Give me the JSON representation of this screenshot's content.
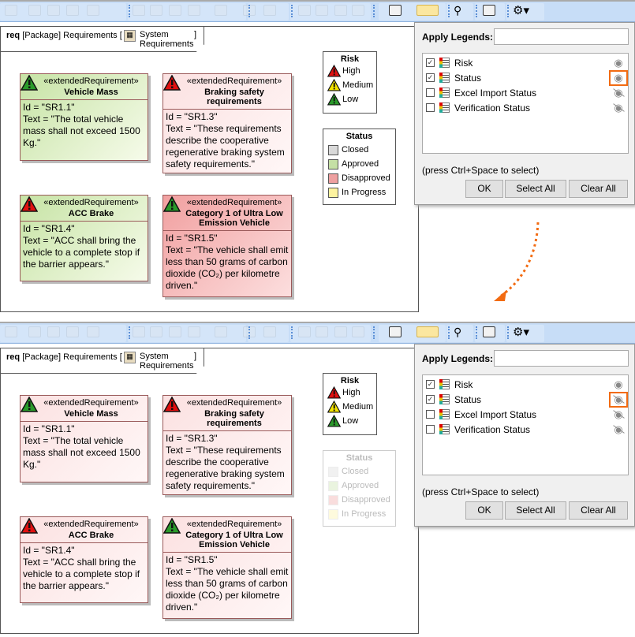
{
  "panels": [
    {
      "diagram_header": {
        "kind": "req",
        "type": "[Package]",
        "name": "Requirements [",
        "package": "System Requirements",
        "close": "]"
      },
      "requirements": [
        {
          "stereotype": "«extendedRequirement»",
          "name": "Vehicle Mass",
          "id": "Id = \"SR1.1\"",
          "text": "Text = \"The total vehicle mass shall not exceed 1500 Kg.\"",
          "risk": "low",
          "status": "approved"
        },
        {
          "stereotype": "«extendedRequirement»",
          "name": "Braking safety requirements",
          "id": "Id = \"SR1.3\"",
          "text": "Text = \"These requirements describe the cooperative regenerative braking system safety requirements.\"",
          "risk": "high",
          "status": "none"
        },
        {
          "stereotype": "«extendedRequirement»",
          "name": "ACC Brake",
          "id": "Id = \"SR1.4\"",
          "text": "Text = \"ACC shall bring the vehicle to a complete stop if the barrier appears.\"",
          "risk": "high",
          "status": "approved"
        },
        {
          "stereotype": "«extendedRequirement»",
          "name": "Category 1 of Ultra Low Emission Vehicle",
          "id": "Id = \"SR1.5\"",
          "text": "Text = \"The vehicle shall emit less than 50 grams of carbon dioxide (CO₂) per kilometre driven.\"",
          "risk": "low",
          "status": "disapproved"
        }
      ],
      "risk_legend": {
        "title": "Risk",
        "items": [
          {
            "label": "High",
            "color": "#e01010"
          },
          {
            "label": "Medium",
            "color": "#f5e400"
          },
          {
            "label": "Low",
            "color": "#2a9a2a"
          }
        ]
      },
      "status_legend": {
        "title": "Status",
        "visible": true,
        "items": [
          {
            "label": "Closed",
            "color": "#d9d9d9"
          },
          {
            "label": "Approved",
            "color": "#c5e0a5"
          },
          {
            "label": "Disapproved",
            "color": "#eea0a0"
          },
          {
            "label": "In Progress",
            "color": "#fdf3a0"
          }
        ]
      },
      "dialog": {
        "title": "Apply Legends:",
        "search_value": "",
        "hint": "(press Ctrl+Space to select)",
        "ok": "OK",
        "select_all": "Select All",
        "clear_all": "Clear All",
        "items": [
          {
            "label": "Risk",
            "checked": true,
            "visible": true
          },
          {
            "label": "Status",
            "checked": true,
            "visible": true
          },
          {
            "label": "Excel Import Status",
            "checked": false,
            "visible": false
          },
          {
            "label": "Verification Status",
            "checked": false,
            "visible": false
          }
        ]
      }
    },
    {
      "diagram_header": {
        "kind": "req",
        "type": "[Package]",
        "name": "Requirements [",
        "package": "System Requirements",
        "close": "]"
      },
      "requirements": [
        {
          "stereotype": "«extendedRequirement»",
          "name": "Vehicle Mass",
          "id": "Id = \"SR1.1\"",
          "text": "Text = \"The total vehicle mass shall not exceed 1500 Kg.\"",
          "risk": "low",
          "status": "none"
        },
        {
          "stereotype": "«extendedRequirement»",
          "name": "Braking safety requirements",
          "id": "Id = \"SR1.3\"",
          "text": "Text = \"These requirements describe the cooperative regenerative braking system safety requirements.\"",
          "risk": "high",
          "status": "none"
        },
        {
          "stereotype": "«extendedRequirement»",
          "name": "ACC Brake",
          "id": "Id = \"SR1.4\"",
          "text": "Text = \"ACC shall bring the vehicle to a complete stop if the barrier appears.\"",
          "risk": "high",
          "status": "none"
        },
        {
          "stereotype": "«extendedRequirement»",
          "name": "Category 1 of Ultra Low Emission Vehicle",
          "id": "Id = \"SR1.5\"",
          "text": "Text = \"The vehicle shall emit less than 50 grams of carbon dioxide (CO₂) per kilometre driven.\"",
          "risk": "low",
          "status": "none"
        }
      ],
      "risk_legend": {
        "title": "Risk",
        "items": [
          {
            "label": "High",
            "color": "#e01010"
          },
          {
            "label": "Medium",
            "color": "#f5e400"
          },
          {
            "label": "Low",
            "color": "#2a9a2a"
          }
        ]
      },
      "status_legend": {
        "title": "Status",
        "visible": false,
        "items": [
          {
            "label": "Closed",
            "color": "#d9d9d9"
          },
          {
            "label": "Approved",
            "color": "#c5e0a5"
          },
          {
            "label": "Disapproved",
            "color": "#eea0a0"
          },
          {
            "label": "In Progress",
            "color": "#fdf3a0"
          }
        ]
      },
      "dialog": {
        "title": "Apply Legends:",
        "search_value": "",
        "hint": "(press Ctrl+Space to select)",
        "ok": "OK",
        "select_all": "Select All",
        "clear_all": "Clear All",
        "items": [
          {
            "label": "Risk",
            "checked": true,
            "visible": true
          },
          {
            "label": "Status",
            "checked": true,
            "visible": false
          },
          {
            "label": "Excel Import Status",
            "checked": false,
            "visible": false
          },
          {
            "label": "Verification Status",
            "checked": false,
            "visible": false
          }
        ]
      }
    }
  ],
  "highlight": {
    "color": "#f26b12"
  }
}
